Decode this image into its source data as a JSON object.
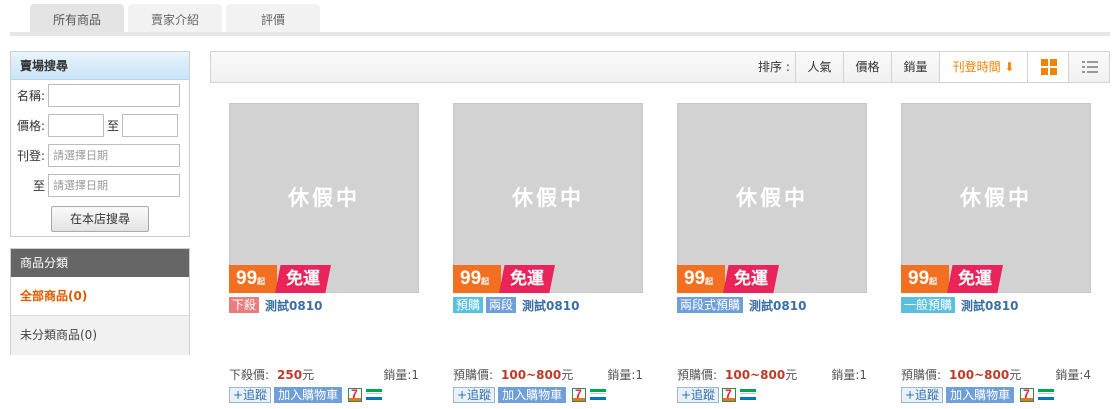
{
  "tabs": [
    {
      "label": "所有商品",
      "active": true
    },
    {
      "label": "賣家介紹",
      "active": false
    },
    {
      "label": "評價",
      "active": false
    }
  ],
  "search": {
    "title": "賣場搜尋",
    "name_label": "名稱:",
    "price_label": "價格:",
    "price_to": "至",
    "date_label": "刊登:",
    "date_to": "至",
    "date_placeholder": "請選擇日期",
    "button": "在本店搜尋"
  },
  "categories": {
    "title": "商品分類",
    "items": [
      {
        "label": "全部商品(0)",
        "active": true
      },
      {
        "label": "未分類商品(0)",
        "active": false
      }
    ]
  },
  "sort": {
    "label": "排序 :",
    "options": [
      {
        "label": "人氣",
        "active": false
      },
      {
        "label": "價格",
        "active": false
      },
      {
        "label": "銷量",
        "active": false
      },
      {
        "label": "刊登時間 ⬇",
        "active": true
      }
    ],
    "views": [
      "grid-view-icon",
      "list-view-icon"
    ]
  },
  "colors": {
    "accent_orange": "#f08300",
    "promo_orange": "#f37021",
    "promo_pink": "#e8245a",
    "price_red": "#c0392b",
    "link_blue": "#3a6ea5"
  },
  "promo": {
    "amount": "99",
    "suffix": "起",
    "free": "免運"
  },
  "thumb_text": "休假中",
  "products": [
    {
      "tags": [
        {
          "label": "下殺",
          "color": "red"
        }
      ],
      "name": "測試0810",
      "price_label": "下殺價:",
      "price": "250",
      "unit": "元",
      "sales": "銷量:1",
      "follow": "+追蹤",
      "cart": "加入購物車"
    },
    {
      "tags": [
        {
          "label": "預購",
          "color": "teal"
        },
        {
          "label": "兩段",
          "color": "blue"
        }
      ],
      "name": "測試0810",
      "price_label": "預購價:",
      "price": "100~800",
      "unit": "元",
      "sales": "銷量:1",
      "follow": "+追蹤",
      "cart": "加入購物車"
    },
    {
      "tags": [
        {
          "label": "兩段式預購",
          "color": "blue"
        }
      ],
      "name": "測試0810",
      "price_label": "預購價:",
      "price": "100~800",
      "unit": "元",
      "sales": "銷量:1",
      "follow": "+追蹤",
      "cart": ""
    },
    {
      "tags": [
        {
          "label": "一般預購",
          "color": "teal"
        }
      ],
      "name": "測試0810",
      "price_label": "預購價:",
      "price": "100~800",
      "unit": "元",
      "sales": "銷量:4",
      "follow": "+追蹤",
      "cart": "加入購物車"
    }
  ]
}
